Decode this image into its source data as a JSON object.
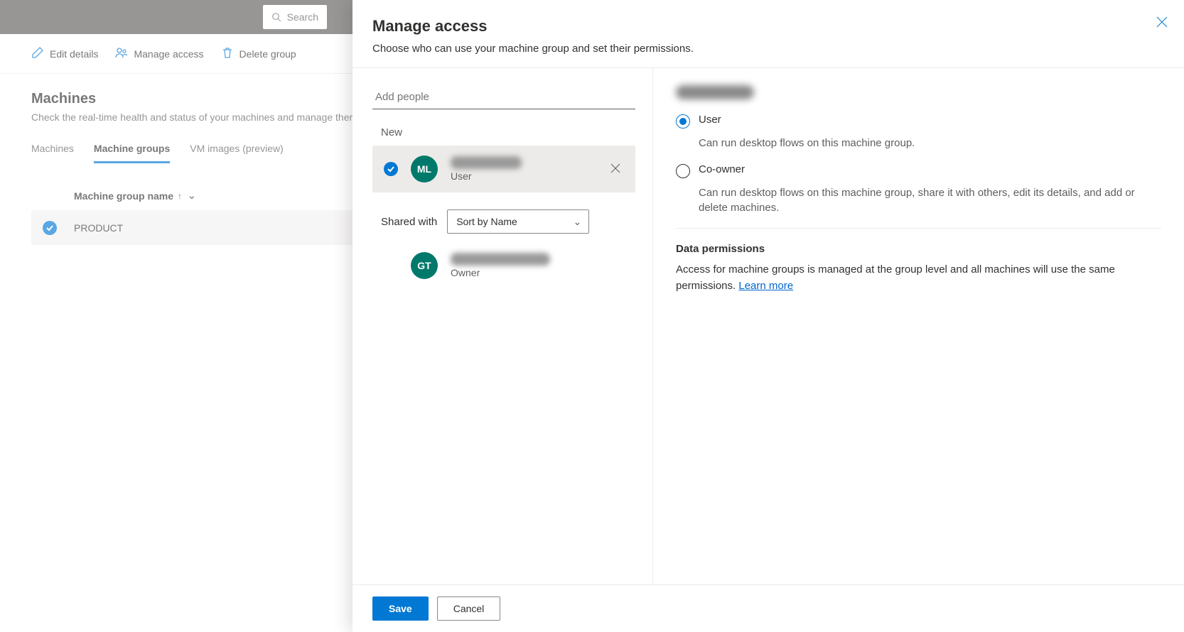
{
  "topbar": {
    "search_placeholder": "Search"
  },
  "commands": {
    "edit": "Edit details",
    "manage": "Manage access",
    "delete": "Delete group"
  },
  "page": {
    "title": "Machines",
    "subtitle": "Check the real-time health and status of your machines and manage them."
  },
  "tabs": {
    "machines": "Machines",
    "groups": "Machine groups",
    "vm": "VM images (preview)"
  },
  "table": {
    "col_name": "Machine group name",
    "row0": "PRODUCT"
  },
  "panel": {
    "title": "Manage access",
    "subtitle": "Choose who can use your machine group and set their permissions.",
    "add_people_placeholder": "Add people",
    "new_label": "New",
    "shared_with_label": "Shared with",
    "sort_value": "Sort by Name",
    "people": {
      "p0": {
        "initials": "ML",
        "role": "User"
      },
      "p1": {
        "initials": "GT",
        "role": "Owner"
      }
    },
    "perm": {
      "user_label": "User",
      "user_desc": "Can run desktop flows on this machine group.",
      "coowner_label": "Co-owner",
      "coowner_desc": "Can run desktop flows on this machine group, share it with others, edit its details, and add or delete machines."
    },
    "data_perm": {
      "heading": "Data permissions",
      "text": "Access for machine groups is managed at the group level and all machines will use the same permissions. ",
      "link": "Learn more"
    },
    "footer": {
      "save": "Save",
      "cancel": "Cancel"
    }
  }
}
